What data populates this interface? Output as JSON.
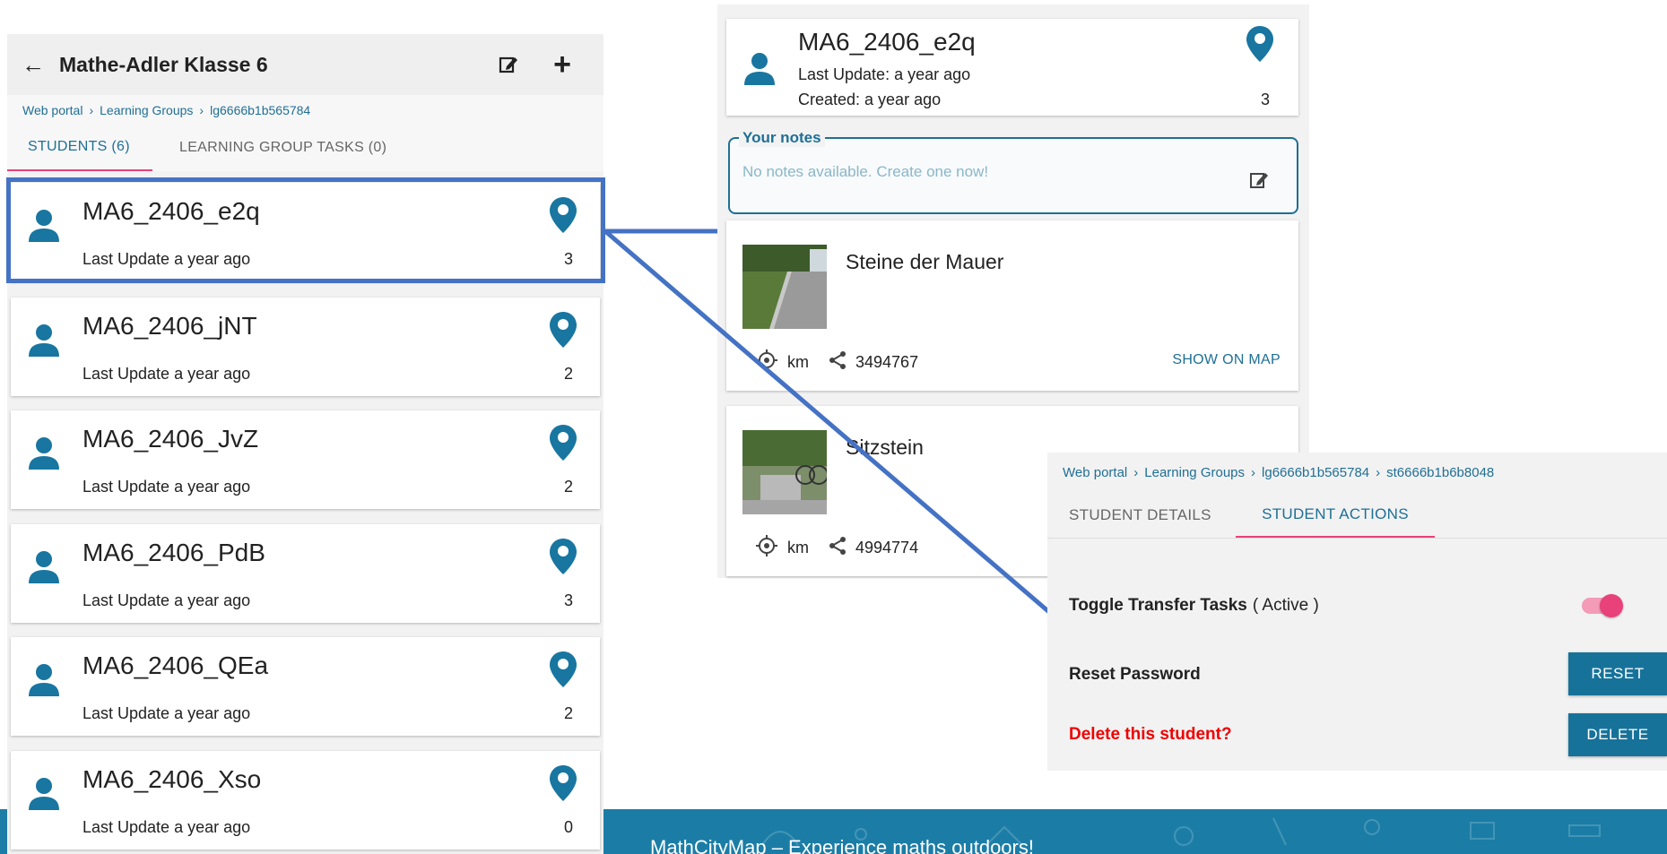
{
  "colors": {
    "accent": "#1f6f95",
    "pin": "#1876a0",
    "tab_indicator": "#e9417a",
    "highlight": "#4472c4",
    "danger": "#ee0000",
    "button": "#17729a",
    "footer": "#1b7da6"
  },
  "left": {
    "title": "Mathe-Adler Klasse 6",
    "breadcrumb": [
      "Web portal",
      "Learning Groups",
      "lg6666b1b565784"
    ],
    "tabs": [
      {
        "label": "STUDENTS (6)",
        "active": true
      },
      {
        "label": "LEARNING GROUP TASKS (0)",
        "active": false
      }
    ],
    "students": [
      {
        "name": "MA6_2406_e2q",
        "update": "Last Update a year ago",
        "count": "3"
      },
      {
        "name": "MA6_2406_jNT",
        "update": "Last Update a year ago",
        "count": "2"
      },
      {
        "name": "MA6_2406_JvZ",
        "update": "Last Update a year ago",
        "count": "2"
      },
      {
        "name": "MA6_2406_PdB",
        "update": "Last Update a year ago",
        "count": "3"
      },
      {
        "name": "MA6_2406_QEa",
        "update": "Last Update a year ago",
        "count": "2"
      },
      {
        "name": "MA6_2406_Xso",
        "update": "Last Update a year ago",
        "count": "0"
      }
    ]
  },
  "middle": {
    "student": {
      "name": "MA6_2406_e2q",
      "last_update": "Last Update: a year ago",
      "created": "Created: a year ago",
      "count": "3"
    },
    "notes": {
      "legend": "Your notes",
      "placeholder": "No notes available. Create one now!"
    },
    "tasks": [
      {
        "title": "Steine der Mauer",
        "distance_unit": "km",
        "code": "3494767",
        "show_on_map": "SHOW ON MAP"
      },
      {
        "title": "Sitzstein",
        "distance_unit": "km",
        "code": "4994774"
      }
    ]
  },
  "right": {
    "breadcrumb": [
      "Web portal",
      "Learning Groups",
      "lg6666b1b565784",
      "st6666b1b6b8048"
    ],
    "tabs": [
      {
        "label": "STUDENT DETAILS",
        "active": false
      },
      {
        "label": "STUDENT ACTIONS",
        "active": true
      }
    ],
    "actions": {
      "toggle_label": "Toggle Transfer Tasks",
      "toggle_state": "( Active )",
      "toggle_on": true,
      "reset_label": "Reset Password",
      "reset_button": "RESET",
      "delete_label": "Delete this student?",
      "delete_button": "DELETE"
    }
  },
  "footer": {
    "text": "MathCityMap – Experience maths outdoors!"
  }
}
